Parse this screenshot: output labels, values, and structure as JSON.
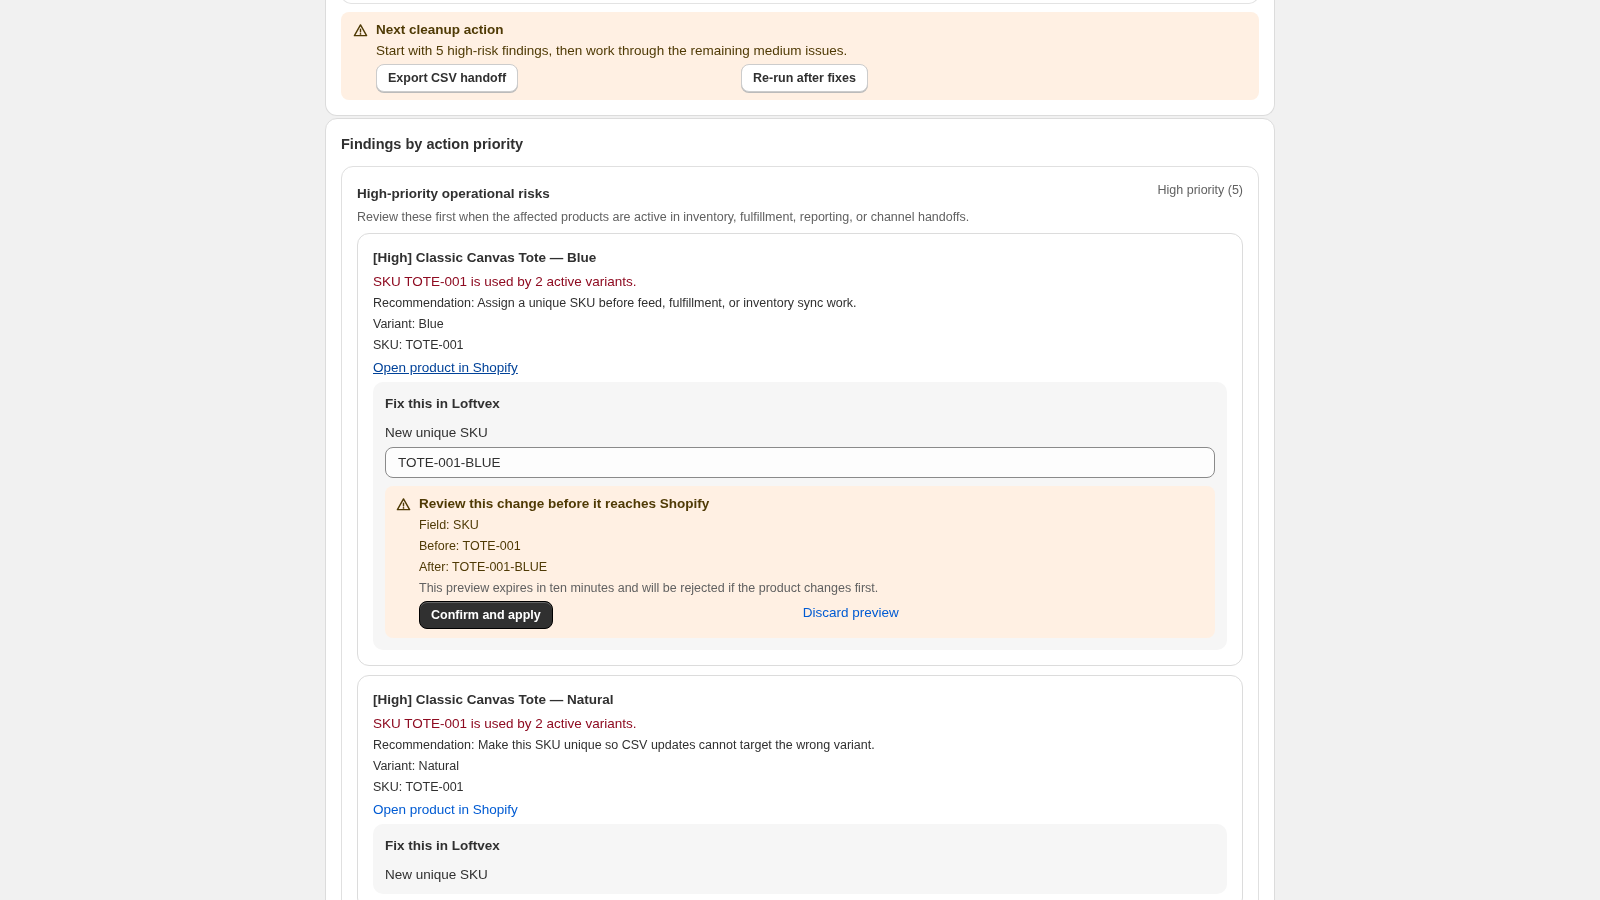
{
  "cleanup_banner": {
    "title": "Next cleanup action",
    "message": "Start with 5 high-risk findings, then work through the remaining medium issues.",
    "buttons": [
      "Export CSV handoff",
      "Re-run after fixes"
    ]
  },
  "findings": {
    "title": "Findings by action priority",
    "group": {
      "title": "High-priority operational risks",
      "badge": "High priority (5)",
      "description": "Review these first when the affected products are active in inventory, fulfillment, reporting, or channel handoffs.",
      "items": [
        {
          "title": "[High] Classic Canvas Tote — Blue",
          "issue": "SKU TOTE-001 is used by 2 active variants.",
          "recommendation": "Recommendation: Assign a unique SKU before feed, fulfillment, or inventory sync work.",
          "variant": "Variant: Blue",
          "sku": "SKU: TOTE-001",
          "link": {
            "label": "Open product in Shopify",
            "hovered": true
          },
          "fix": {
            "title": "Fix this in Loftvex",
            "field_label": "New unique SKU",
            "value": "TOTE-001-BLUE",
            "preview": {
              "title": "Review this change before it reaches Shopify",
              "lines": [
                "Field: SKU",
                "Before: TOTE-001",
                "After: TOTE-001-BLUE"
              ],
              "note": "This preview expires in ten minutes and will be rejected if the product changes first.",
              "confirm": "Confirm and apply",
              "discard": "Discard preview"
            }
          }
        },
        {
          "title": "[High] Classic Canvas Tote — Natural",
          "issue": "SKU TOTE-001 is used by 2 active variants.",
          "recommendation": "Recommendation: Make this SKU unique so CSV updates cannot target the wrong variant.",
          "variant": "Variant: Natural",
          "sku": "SKU: TOTE-001",
          "link": {
            "label": "Open product in Shopify",
            "hovered": false
          },
          "fix": {
            "title": "Fix this in Loftvex",
            "field_label": "New unique SKU"
          }
        }
      ]
    }
  }
}
